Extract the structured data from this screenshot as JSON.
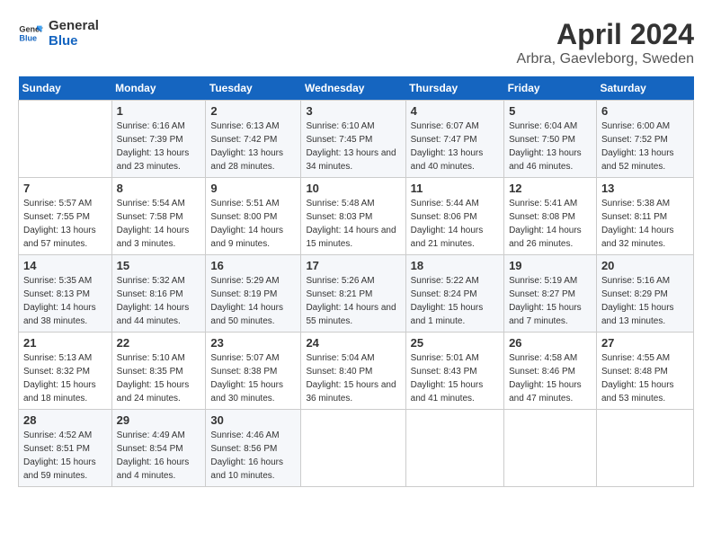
{
  "header": {
    "logo_line1": "General",
    "logo_line2": "Blue",
    "title": "April 2024",
    "subtitle": "Arbra, Gaevleborg, Sweden"
  },
  "weekdays": [
    "Sunday",
    "Monday",
    "Tuesday",
    "Wednesday",
    "Thursday",
    "Friday",
    "Saturday"
  ],
  "weeks": [
    [
      {
        "day": "",
        "sunrise": "",
        "sunset": "",
        "daylight": ""
      },
      {
        "day": "1",
        "sunrise": "Sunrise: 6:16 AM",
        "sunset": "Sunset: 7:39 PM",
        "daylight": "Daylight: 13 hours and 23 minutes."
      },
      {
        "day": "2",
        "sunrise": "Sunrise: 6:13 AM",
        "sunset": "Sunset: 7:42 PM",
        "daylight": "Daylight: 13 hours and 28 minutes."
      },
      {
        "day": "3",
        "sunrise": "Sunrise: 6:10 AM",
        "sunset": "Sunset: 7:45 PM",
        "daylight": "Daylight: 13 hours and 34 minutes."
      },
      {
        "day": "4",
        "sunrise": "Sunrise: 6:07 AM",
        "sunset": "Sunset: 7:47 PM",
        "daylight": "Daylight: 13 hours and 40 minutes."
      },
      {
        "day": "5",
        "sunrise": "Sunrise: 6:04 AM",
        "sunset": "Sunset: 7:50 PM",
        "daylight": "Daylight: 13 hours and 46 minutes."
      },
      {
        "day": "6",
        "sunrise": "Sunrise: 6:00 AM",
        "sunset": "Sunset: 7:52 PM",
        "daylight": "Daylight: 13 hours and 52 minutes."
      }
    ],
    [
      {
        "day": "7",
        "sunrise": "Sunrise: 5:57 AM",
        "sunset": "Sunset: 7:55 PM",
        "daylight": "Daylight: 13 hours and 57 minutes."
      },
      {
        "day": "8",
        "sunrise": "Sunrise: 5:54 AM",
        "sunset": "Sunset: 7:58 PM",
        "daylight": "Daylight: 14 hours and 3 minutes."
      },
      {
        "day": "9",
        "sunrise": "Sunrise: 5:51 AM",
        "sunset": "Sunset: 8:00 PM",
        "daylight": "Daylight: 14 hours and 9 minutes."
      },
      {
        "day": "10",
        "sunrise": "Sunrise: 5:48 AM",
        "sunset": "Sunset: 8:03 PM",
        "daylight": "Daylight: 14 hours and 15 minutes."
      },
      {
        "day": "11",
        "sunrise": "Sunrise: 5:44 AM",
        "sunset": "Sunset: 8:06 PM",
        "daylight": "Daylight: 14 hours and 21 minutes."
      },
      {
        "day": "12",
        "sunrise": "Sunrise: 5:41 AM",
        "sunset": "Sunset: 8:08 PM",
        "daylight": "Daylight: 14 hours and 26 minutes."
      },
      {
        "day": "13",
        "sunrise": "Sunrise: 5:38 AM",
        "sunset": "Sunset: 8:11 PM",
        "daylight": "Daylight: 14 hours and 32 minutes."
      }
    ],
    [
      {
        "day": "14",
        "sunrise": "Sunrise: 5:35 AM",
        "sunset": "Sunset: 8:13 PM",
        "daylight": "Daylight: 14 hours and 38 minutes."
      },
      {
        "day": "15",
        "sunrise": "Sunrise: 5:32 AM",
        "sunset": "Sunset: 8:16 PM",
        "daylight": "Daylight: 14 hours and 44 minutes."
      },
      {
        "day": "16",
        "sunrise": "Sunrise: 5:29 AM",
        "sunset": "Sunset: 8:19 PM",
        "daylight": "Daylight: 14 hours and 50 minutes."
      },
      {
        "day": "17",
        "sunrise": "Sunrise: 5:26 AM",
        "sunset": "Sunset: 8:21 PM",
        "daylight": "Daylight: 14 hours and 55 minutes."
      },
      {
        "day": "18",
        "sunrise": "Sunrise: 5:22 AM",
        "sunset": "Sunset: 8:24 PM",
        "daylight": "Daylight: 15 hours and 1 minute."
      },
      {
        "day": "19",
        "sunrise": "Sunrise: 5:19 AM",
        "sunset": "Sunset: 8:27 PM",
        "daylight": "Daylight: 15 hours and 7 minutes."
      },
      {
        "day": "20",
        "sunrise": "Sunrise: 5:16 AM",
        "sunset": "Sunset: 8:29 PM",
        "daylight": "Daylight: 15 hours and 13 minutes."
      }
    ],
    [
      {
        "day": "21",
        "sunrise": "Sunrise: 5:13 AM",
        "sunset": "Sunset: 8:32 PM",
        "daylight": "Daylight: 15 hours and 18 minutes."
      },
      {
        "day": "22",
        "sunrise": "Sunrise: 5:10 AM",
        "sunset": "Sunset: 8:35 PM",
        "daylight": "Daylight: 15 hours and 24 minutes."
      },
      {
        "day": "23",
        "sunrise": "Sunrise: 5:07 AM",
        "sunset": "Sunset: 8:38 PM",
        "daylight": "Daylight: 15 hours and 30 minutes."
      },
      {
        "day": "24",
        "sunrise": "Sunrise: 5:04 AM",
        "sunset": "Sunset: 8:40 PM",
        "daylight": "Daylight: 15 hours and 36 minutes."
      },
      {
        "day": "25",
        "sunrise": "Sunrise: 5:01 AM",
        "sunset": "Sunset: 8:43 PM",
        "daylight": "Daylight: 15 hours and 41 minutes."
      },
      {
        "day": "26",
        "sunrise": "Sunrise: 4:58 AM",
        "sunset": "Sunset: 8:46 PM",
        "daylight": "Daylight: 15 hours and 47 minutes."
      },
      {
        "day": "27",
        "sunrise": "Sunrise: 4:55 AM",
        "sunset": "Sunset: 8:48 PM",
        "daylight": "Daylight: 15 hours and 53 minutes."
      }
    ],
    [
      {
        "day": "28",
        "sunrise": "Sunrise: 4:52 AM",
        "sunset": "Sunset: 8:51 PM",
        "daylight": "Daylight: 15 hours and 59 minutes."
      },
      {
        "day": "29",
        "sunrise": "Sunrise: 4:49 AM",
        "sunset": "Sunset: 8:54 PM",
        "daylight": "Daylight: 16 hours and 4 minutes."
      },
      {
        "day": "30",
        "sunrise": "Sunrise: 4:46 AM",
        "sunset": "Sunset: 8:56 PM",
        "daylight": "Daylight: 16 hours and 10 minutes."
      },
      {
        "day": "",
        "sunrise": "",
        "sunset": "",
        "daylight": ""
      },
      {
        "day": "",
        "sunrise": "",
        "sunset": "",
        "daylight": ""
      },
      {
        "day": "",
        "sunrise": "",
        "sunset": "",
        "daylight": ""
      },
      {
        "day": "",
        "sunrise": "",
        "sunset": "",
        "daylight": ""
      }
    ]
  ]
}
